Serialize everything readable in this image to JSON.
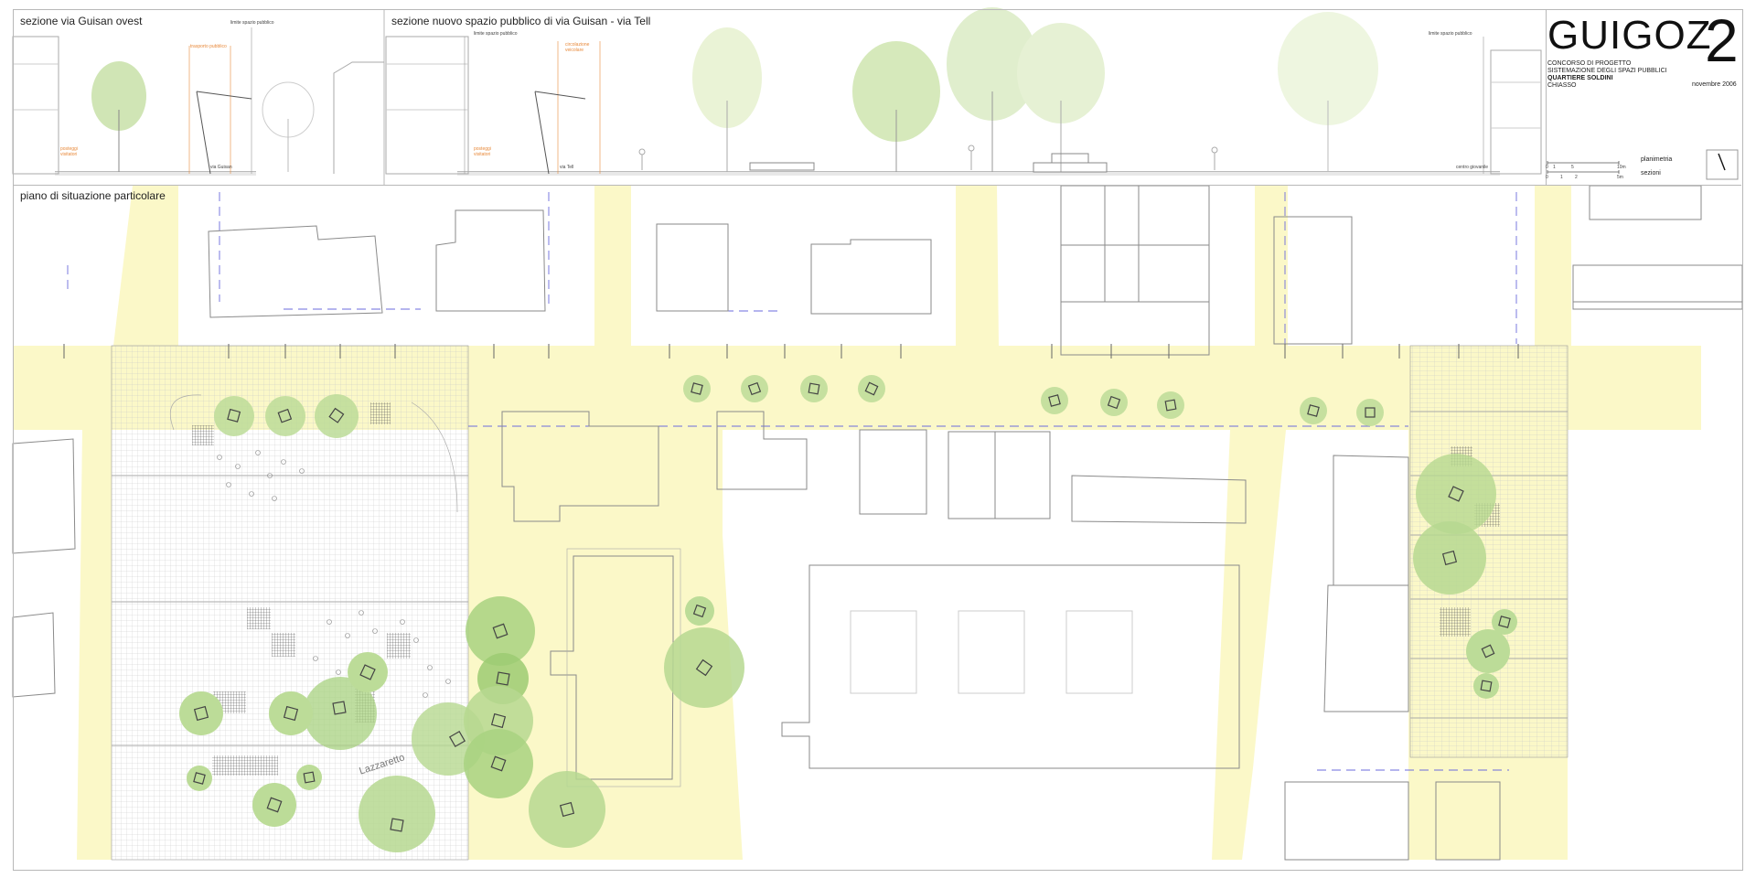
{
  "sections": {
    "west_title": "sezione via Guisan ovest",
    "new_title": "sezione nuovo spazio pubblico di via Guisan - via Tell",
    "limit_label": "limite spazio pubblico",
    "transit_label": "trasporto pubblico",
    "circulation_label": "circolazione veicolare",
    "parking_label": "posteggi visitatori",
    "via_guisan": "via Guisan",
    "via_tell": "via Tell",
    "centro_giovanile": "centro giovanile"
  },
  "title_block": {
    "project": "GUIGOZ",
    "sheet_number": "2",
    "line1": "CONCORSO DI PROGETTO",
    "line2": "SISTEMAZIONE DEGLI SPAZI PUBBLICI",
    "line3": "QUARTIERE SOLDINI",
    "line4": "CHIASSO",
    "date": "novembre 2006",
    "scale_plan_label": "planimetria",
    "scale_section_label": "sezioni",
    "scale_plan_ticks": [
      "0",
      "1",
      "5",
      "10m"
    ],
    "scale_section_ticks": [
      "0",
      "1",
      "2",
      "5m"
    ]
  },
  "plan": {
    "title": "piano di situazione particolare",
    "street_label": "Lazzaretto"
  },
  "colors": {
    "public_space": "#fbf8c8",
    "tree_light": "#c8e0a8",
    "tree_mid": "#9fce7c",
    "tree_dark": "#7cb85a",
    "building_line": "#8a8a8a",
    "grid": "#c4c4c4",
    "boundary_dash": "#6b6bdc",
    "accent_orange": "#e8893a"
  }
}
